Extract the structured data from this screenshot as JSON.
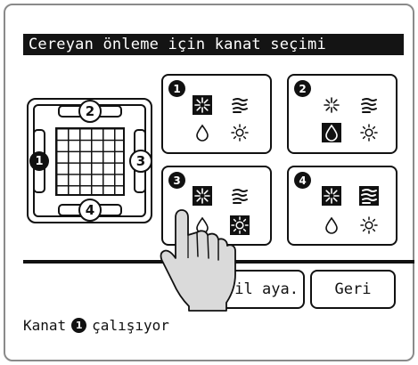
{
  "title": "Cereyan önleme için kanat seçimi",
  "unit_diagram": {
    "louver_labels": [
      "1",
      "2",
      "3",
      "4"
    ]
  },
  "panels": [
    {
      "number": "1",
      "selected_mode": "cool"
    },
    {
      "number": "2",
      "selected_mode": "dry"
    },
    {
      "number": "3",
      "selected_mode": "heat"
    },
    {
      "number": "4",
      "selected_mode": "fan"
    }
  ],
  "mode_icons": [
    "snowflake-icon",
    "fan-icon",
    "droplet-icon",
    "sun-icon"
  ],
  "buttons": {
    "pil_label": "Pil aya.",
    "back_label": "Geri"
  },
  "status": {
    "prefix": "Kanat",
    "number": "1",
    "suffix": "çalışıyor"
  },
  "colors": {
    "foreground": "#111111",
    "background": "#ffffff",
    "frame": "#8a8a8a"
  }
}
